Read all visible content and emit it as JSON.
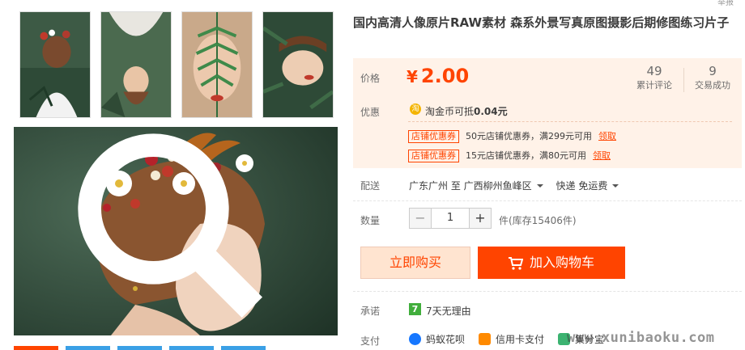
{
  "product": {
    "title": "国内高清人像原片RAW素材 森系外景写真原图摄影后期修图练习片子",
    "corner_text": "举报"
  },
  "price": {
    "label": "价格",
    "currency_symbol": "¥",
    "value": "2.00"
  },
  "stats": [
    {
      "num": "49",
      "label": "累计评论"
    },
    {
      "num": "9",
      "label": "交易成功"
    }
  ],
  "discount": {
    "label": "优惠",
    "coin_icon_char": "淘",
    "coin_prefix": "淘金币可抵",
    "coin_amount": "0.04元",
    "coupons": [
      {
        "tag": "店铺优惠券",
        "text": "50元店铺优惠券，满299元可用",
        "action": "领取"
      },
      {
        "tag": "店铺优惠券",
        "text": "15元店铺优惠券，满80元可用",
        "action": "领取"
      }
    ]
  },
  "shipping": {
    "label": "配送",
    "from": "广东广州 至",
    "to": "广西柳州鱼峰区",
    "method": "快递 免运费"
  },
  "quantity": {
    "label": "数量",
    "minus": "−",
    "value": "1",
    "plus": "+",
    "stock": "件(库存15406件)"
  },
  "actions": {
    "buy_now": "立即购买",
    "add_to_cart": "加入购物车"
  },
  "promise": {
    "label": "承诺",
    "icon_char": "7",
    "text": "7天无理由"
  },
  "payment": {
    "label": "支付",
    "methods": [
      "蚂蚁花呗",
      "信用卡支付",
      "集分宝"
    ]
  },
  "watermark": "www.xunibaoku.com",
  "colors": {
    "accent": "#ff4400",
    "price": "#ff4400",
    "price_bg": "#fff2e8"
  }
}
